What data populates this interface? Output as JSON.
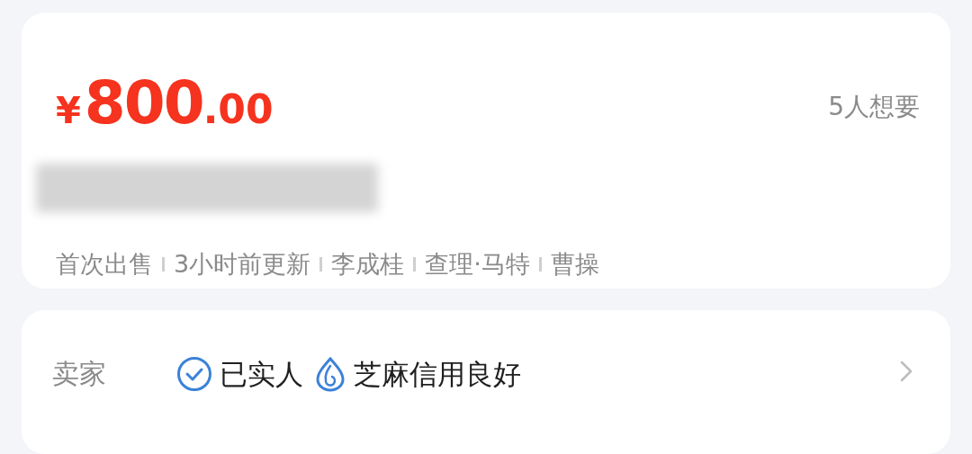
{
  "price": {
    "currency": "¥",
    "integer": "800",
    "decimal": ".00"
  },
  "wants": "5人想要",
  "tags": [
    "首次出售",
    "3小时前更新",
    "李成桂",
    "查理·马特",
    "曹操"
  ],
  "seller": {
    "label": "卖家",
    "badges": [
      {
        "kind": "verified",
        "text": "已实人"
      },
      {
        "kind": "credit",
        "text": "芝麻信用良好"
      }
    ]
  }
}
